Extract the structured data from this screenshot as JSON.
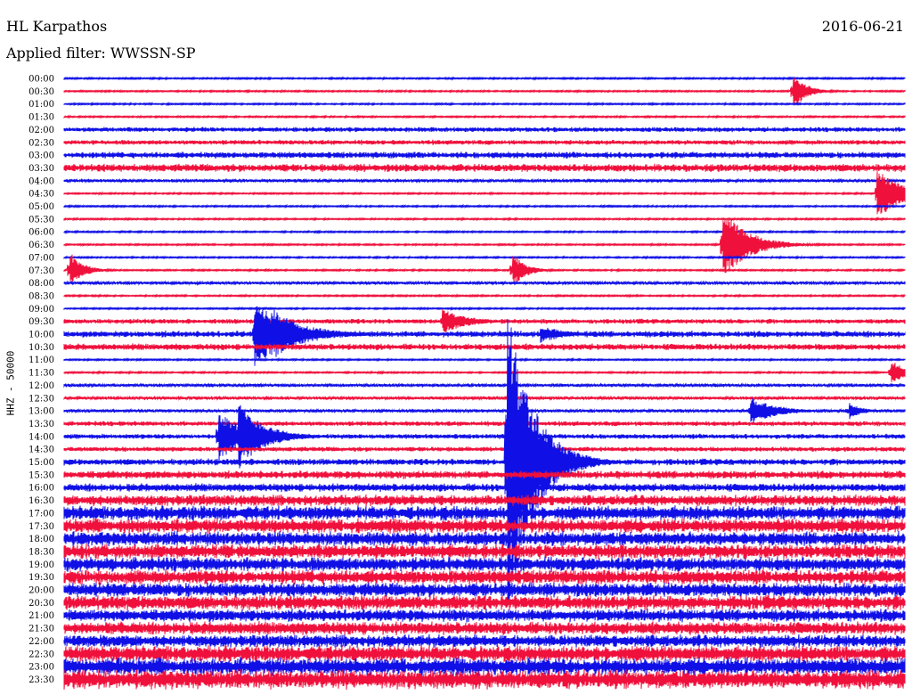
{
  "header": {
    "station": "HL Karpathos",
    "date": "2016-06-21",
    "filter": "Applied filter: WWSSN-SP"
  },
  "chart_data": {
    "type": "line",
    "ylabel": "HHZ - 50000",
    "y_ticks": [
      "00:00",
      "00:30",
      "01:00",
      "01:30",
      "02:00",
      "02:30",
      "03:00",
      "03:30",
      "04:00",
      "04:30",
      "05:00",
      "05:30",
      "06:00",
      "06:30",
      "07:00",
      "07:30",
      "08:00",
      "08:30",
      "09:00",
      "09:30",
      "10:00",
      "10:30",
      "11:00",
      "11:30",
      "12:00",
      "12:30",
      "13:00",
      "13:30",
      "14:00",
      "14:30",
      "15:00",
      "15:30",
      "16:00",
      "16:30",
      "17:00",
      "17:30",
      "18:00",
      "18:30",
      "19:00",
      "19:30",
      "20:00",
      "20:30",
      "21:00",
      "21:30",
      "22:00",
      "22:30",
      "23:00",
      "23:30"
    ],
    "x_minutes": [
      0,
      30
    ],
    "trace_colors": [
      "#1010e6",
      "#f0103c"
    ],
    "noise_amplitude": [
      1,
      1,
      1,
      1,
      3,
      3,
      4,
      5,
      2,
      1,
      1,
      1,
      1,
      1,
      1,
      1,
      2,
      1,
      1,
      3,
      4,
      4,
      1,
      1,
      2,
      2,
      2,
      3,
      3,
      3,
      4,
      5,
      5,
      7,
      9,
      9,
      9,
      9,
      9,
      9,
      9,
      9,
      8,
      8,
      8,
      10,
      11,
      12
    ],
    "events": [
      {
        "row": 1,
        "minute": 26.0,
        "amplitude": 22,
        "duration": 1.0
      },
      {
        "row": 9,
        "minute": 29.0,
        "amplitude": 30,
        "duration": 2.0
      },
      {
        "row": 13,
        "minute": 23.5,
        "amplitude": 40,
        "duration": 2.0
      },
      {
        "row": 15,
        "minute": 0.2,
        "amplitude": 22,
        "duration": 1.0
      },
      {
        "row": 15,
        "minute": 16.0,
        "amplitude": 20,
        "duration": 1.0
      },
      {
        "row": 19,
        "minute": 13.5,
        "amplitude": 14,
        "duration": 2.0
      },
      {
        "row": 20,
        "minute": 6.8,
        "amplitude": 38,
        "duration": 3.0
      },
      {
        "row": 20,
        "minute": 7.5,
        "amplitude": 30,
        "duration": 2.0
      },
      {
        "row": 20,
        "minute": 17.0,
        "amplitude": 10,
        "duration": 2.0
      },
      {
        "row": 23,
        "minute": 29.5,
        "amplitude": 16,
        "duration": 1.0
      },
      {
        "row": 26,
        "minute": 24.5,
        "amplitude": 16,
        "duration": 2.0
      },
      {
        "row": 26,
        "minute": 28.0,
        "amplitude": 10,
        "duration": 1.0
      },
      {
        "row": 28,
        "minute": 6.2,
        "amplitude": 40,
        "duration": 2.0
      },
      {
        "row": 28,
        "minute": 5.5,
        "amplitude": 30,
        "duration": 2.0
      },
      {
        "row": 30,
        "minute": 15.8,
        "amplitude": 180,
        "duration": 2.0
      }
    ]
  }
}
